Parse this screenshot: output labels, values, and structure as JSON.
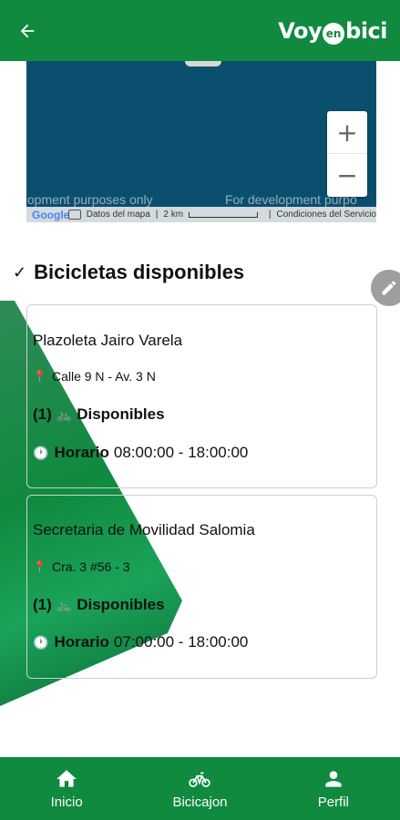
{
  "header": {
    "logo": {
      "part1": "Voy",
      "part2": "en",
      "part3": "bici"
    }
  },
  "map": {
    "watermark_left": "elopment purposes only",
    "watermark_right": "For development purpo",
    "google_logo": "Google",
    "map_data": "Datos del mapa",
    "scale": "2 km",
    "terms": "Condiciones del Servicio",
    "zoom_in": "+",
    "zoom_out": "−"
  },
  "section": {
    "title": "Bicicletas disponibles"
  },
  "stations": [
    {
      "name": "Plazoleta Jairo Varela",
      "address": "Calle 9 N - Av. 3 N",
      "count": "(1)",
      "available_label": "Disponibles",
      "hours_label": "Horario",
      "hours": "08:00:00 - 18:00:00"
    },
    {
      "name": "Secretaria de Movilidad Salomia",
      "address": "Cra. 3 #56 - 3",
      "count": "(1)",
      "available_label": "Disponibles",
      "hours_label": "Horario",
      "hours": "07:00:00 - 18:00:00"
    }
  ],
  "nav": {
    "items": [
      {
        "label": "Inicio",
        "icon": "home-icon"
      },
      {
        "label": "Bicicajon",
        "icon": "bicycle-icon"
      },
      {
        "label": "Perfil",
        "icon": "person-icon"
      }
    ]
  },
  "colors": {
    "brand_green": "#0f8a3f",
    "map_water": "#0b4f6e"
  }
}
